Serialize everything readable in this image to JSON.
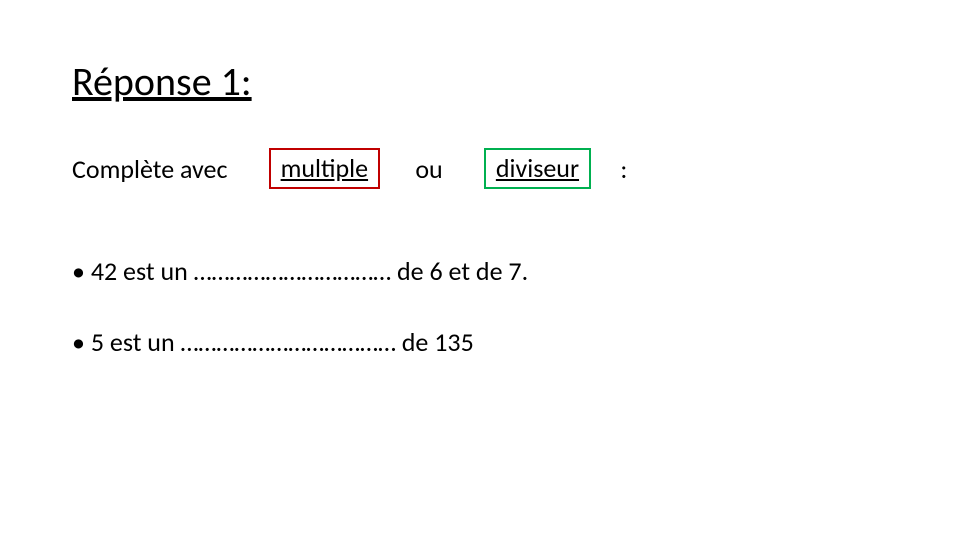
{
  "heading": "Réponse 1:",
  "instruction": {
    "prefix": "Complète avec       ",
    "word_multiple": "multiple",
    "sep": "      ou       ",
    "word_diviseur": "diviseur",
    "suffix": "     :"
  },
  "bullets": [
    "• 42 est un …………………………… de 6 et de 7.",
    "• 5 est un ……………………………… de 135"
  ]
}
